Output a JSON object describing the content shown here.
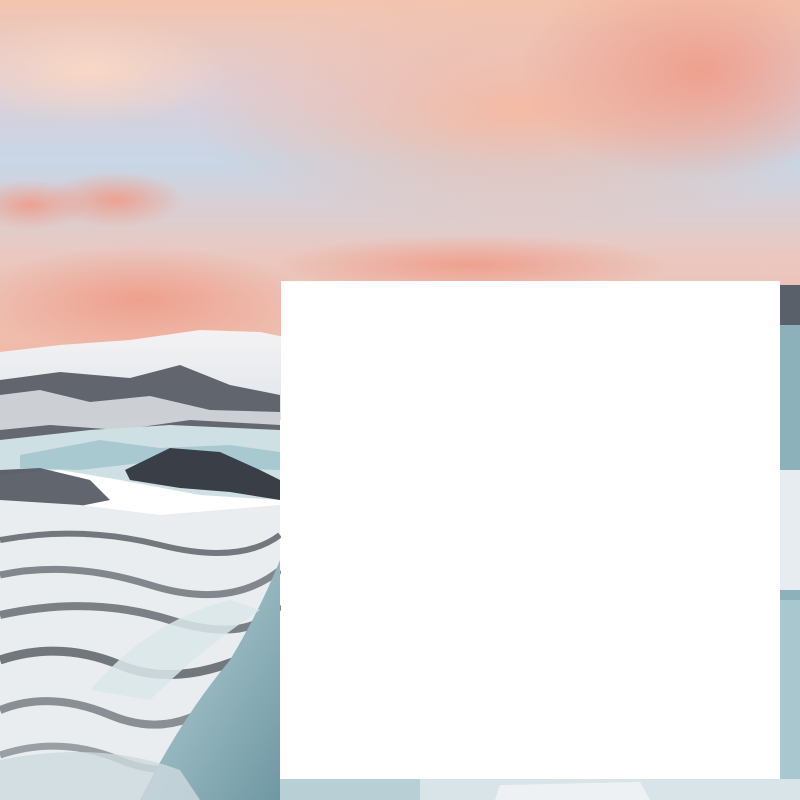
{
  "scene": {
    "description_icon": "glacier-sunset-photo",
    "colors": {
      "sky_top": "#f2c0ab",
      "sky_blue": "#c8d7e6",
      "cloud_pink": "#f0a58f",
      "cloud_light": "#f7cdb8",
      "snow": "#eef0f2",
      "ice_blue": "#a9c8cf",
      "rock_dark": "#3b3f47",
      "ice_deep": "#7fa7b0"
    }
  },
  "panel": {
    "fill": "#ffffff"
  }
}
